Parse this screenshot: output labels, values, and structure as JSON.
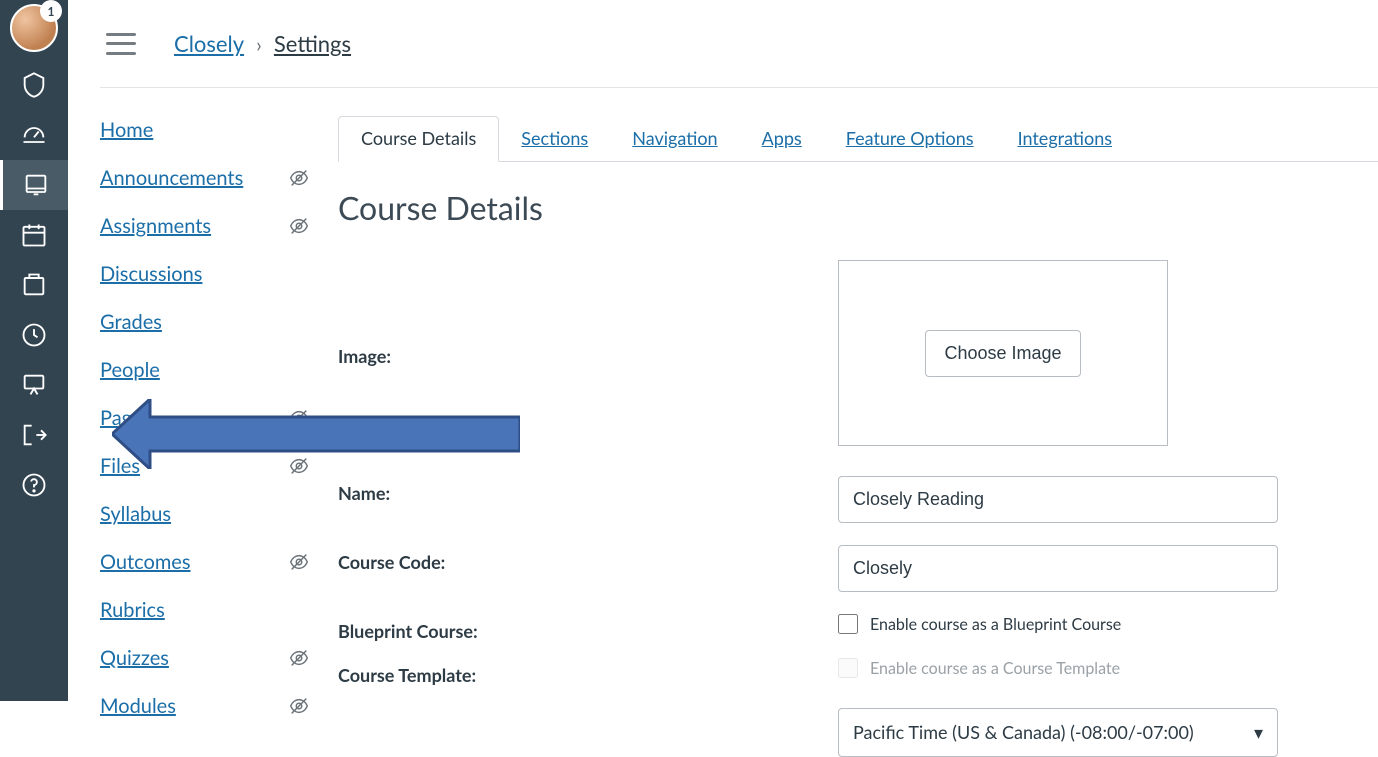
{
  "avatar_badge": "1",
  "breadcrumb": {
    "course": "Closely",
    "current": "Settings"
  },
  "course_nav": [
    {
      "label": "Home",
      "hidden": false
    },
    {
      "label": "Announcements",
      "hidden": true
    },
    {
      "label": "Assignments",
      "hidden": true
    },
    {
      "label": "Discussions",
      "hidden": false
    },
    {
      "label": "Grades",
      "hidden": false
    },
    {
      "label": "People",
      "hidden": false
    },
    {
      "label": "Pages",
      "hidden": true
    },
    {
      "label": "Files",
      "hidden": true
    },
    {
      "label": "Syllabus",
      "hidden": false
    },
    {
      "label": "Outcomes",
      "hidden": true
    },
    {
      "label": "Rubrics",
      "hidden": false
    },
    {
      "label": "Quizzes",
      "hidden": true
    },
    {
      "label": "Modules",
      "hidden": true
    }
  ],
  "tabs": [
    "Course Details",
    "Sections",
    "Navigation",
    "Apps",
    "Feature Options",
    "Integrations"
  ],
  "heading": "Course Details",
  "form": {
    "image_label": "Image:",
    "choose_image": "Choose Image",
    "name_label": "Name:",
    "name_value": "Closely Reading",
    "code_label": "Course Code:",
    "code_value": "Closely",
    "blueprint_label": "Blueprint Course:",
    "blueprint_check": "Enable course as a Blueprint Course",
    "template_label": "Course Template:",
    "template_check": "Enable course as a Course Template",
    "tz_value": "Pacific Time (US & Canada) (-08:00/-07:00)"
  }
}
